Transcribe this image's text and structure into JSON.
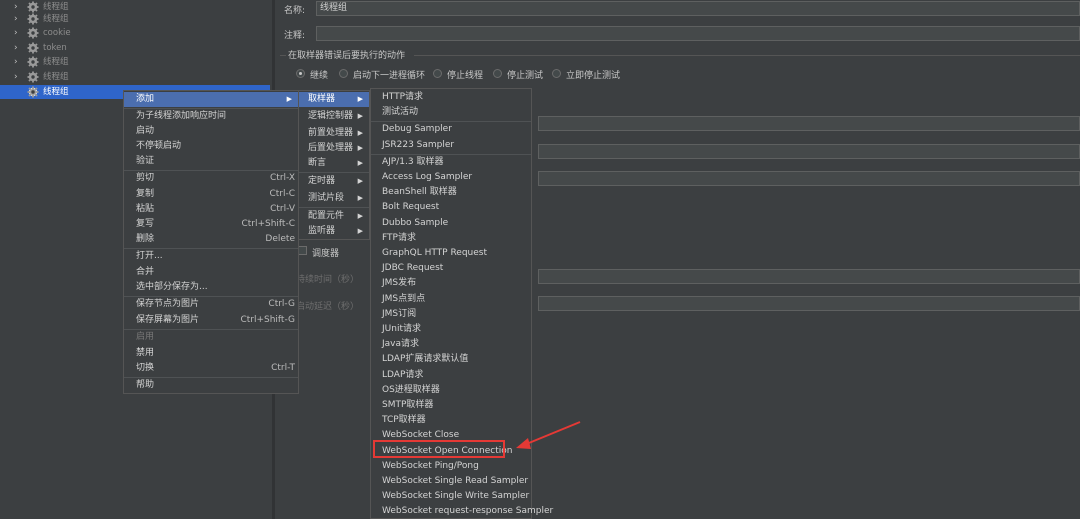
{
  "tree": {
    "items": [
      {
        "label": "线程组",
        "expanded": false
      },
      {
        "label": "线程组",
        "expanded": false
      },
      {
        "label": "cookie",
        "expanded": false
      },
      {
        "label": "token",
        "expanded": false
      },
      {
        "label": "线程组",
        "expanded": false
      },
      {
        "label": "线程组",
        "expanded": false
      },
      {
        "label": "线程组",
        "selected": true
      }
    ]
  },
  "panel": {
    "name_label": "名称:",
    "name_value": "线程组",
    "comment_label": "注释:",
    "error_action_title": "在取样器错误后要执行的动作",
    "radios": [
      {
        "label": "继续",
        "selected": true
      },
      {
        "label": "启动下一进程循环"
      },
      {
        "label": "停止线程"
      },
      {
        "label": "停止测试"
      },
      {
        "label": "立即停止测试"
      }
    ],
    "scheduler_label": "调度器",
    "duration_label": "持续时间（秒）",
    "delay_label": "启动延迟（秒）"
  },
  "context_menu": {
    "items": [
      {
        "label": "添加",
        "submenu": true,
        "highlighted": true
      },
      {
        "label": "为子线程添加响应时间"
      },
      {
        "label": "启动"
      },
      {
        "label": "不停顿启动"
      },
      {
        "label": "验证"
      },
      {
        "label": "剪切",
        "shortcut": "Ctrl-X"
      },
      {
        "label": "复制",
        "shortcut": "Ctrl-C"
      },
      {
        "label": "粘贴",
        "shortcut": "Ctrl-V"
      },
      {
        "label": "复写",
        "shortcut": "Ctrl+Shift-C"
      },
      {
        "label": "删除",
        "shortcut": "Delete"
      },
      {
        "label": "打开..."
      },
      {
        "label": "合并"
      },
      {
        "label": "选中部分保存为..."
      },
      {
        "label": "保存节点为图片",
        "shortcut": "Ctrl-G"
      },
      {
        "label": "保存屏幕为图片",
        "shortcut": "Ctrl+Shift-G"
      },
      {
        "label": "启用",
        "disabled": true
      },
      {
        "label": "禁用"
      },
      {
        "label": "切换",
        "shortcut": "Ctrl-T"
      },
      {
        "label": "帮助"
      }
    ]
  },
  "add_submenu": {
    "items": [
      {
        "label": "取样器",
        "highlighted": true
      },
      {
        "label": "逻辑控制器"
      },
      {
        "label": "前置处理器"
      },
      {
        "label": "后置处理器"
      },
      {
        "label": "断言"
      },
      {
        "label": "定时器"
      },
      {
        "label": "测试片段"
      },
      {
        "label": "配置元件"
      },
      {
        "label": "监听器"
      }
    ]
  },
  "sampler_submenu": {
    "items": [
      "HTTP请求",
      "测试活动",
      "Debug Sampler",
      "JSR223 Sampler",
      "AJP/1.3 取样器",
      "Access Log Sampler",
      "BeanShell 取样器",
      "Bolt Request",
      "Dubbo Sample",
      "FTP请求",
      "GraphQL HTTP Request",
      "JDBC Request",
      "JMS发布",
      "JMS点到点",
      "JMS订阅",
      "JUnit请求",
      "Java请求",
      "LDAP扩展请求默认值",
      "LDAP请求",
      "OS进程取样器",
      "SMTP取样器",
      "TCP取样器",
      "WebSocket Close",
      "WebSocket Open Connection",
      "WebSocket Ping/Pong",
      "WebSocket Single Read Sampler",
      "WebSocket Single Write Sampler",
      "WebSocket request-response Sampler"
    ],
    "boxed_item": "WebSocket Open Connection"
  },
  "colors": {
    "background": "#3c3f41",
    "selection": "#2f65ca",
    "menu_highlight": "#4b6eaf",
    "annotation_red": "#e53935"
  }
}
